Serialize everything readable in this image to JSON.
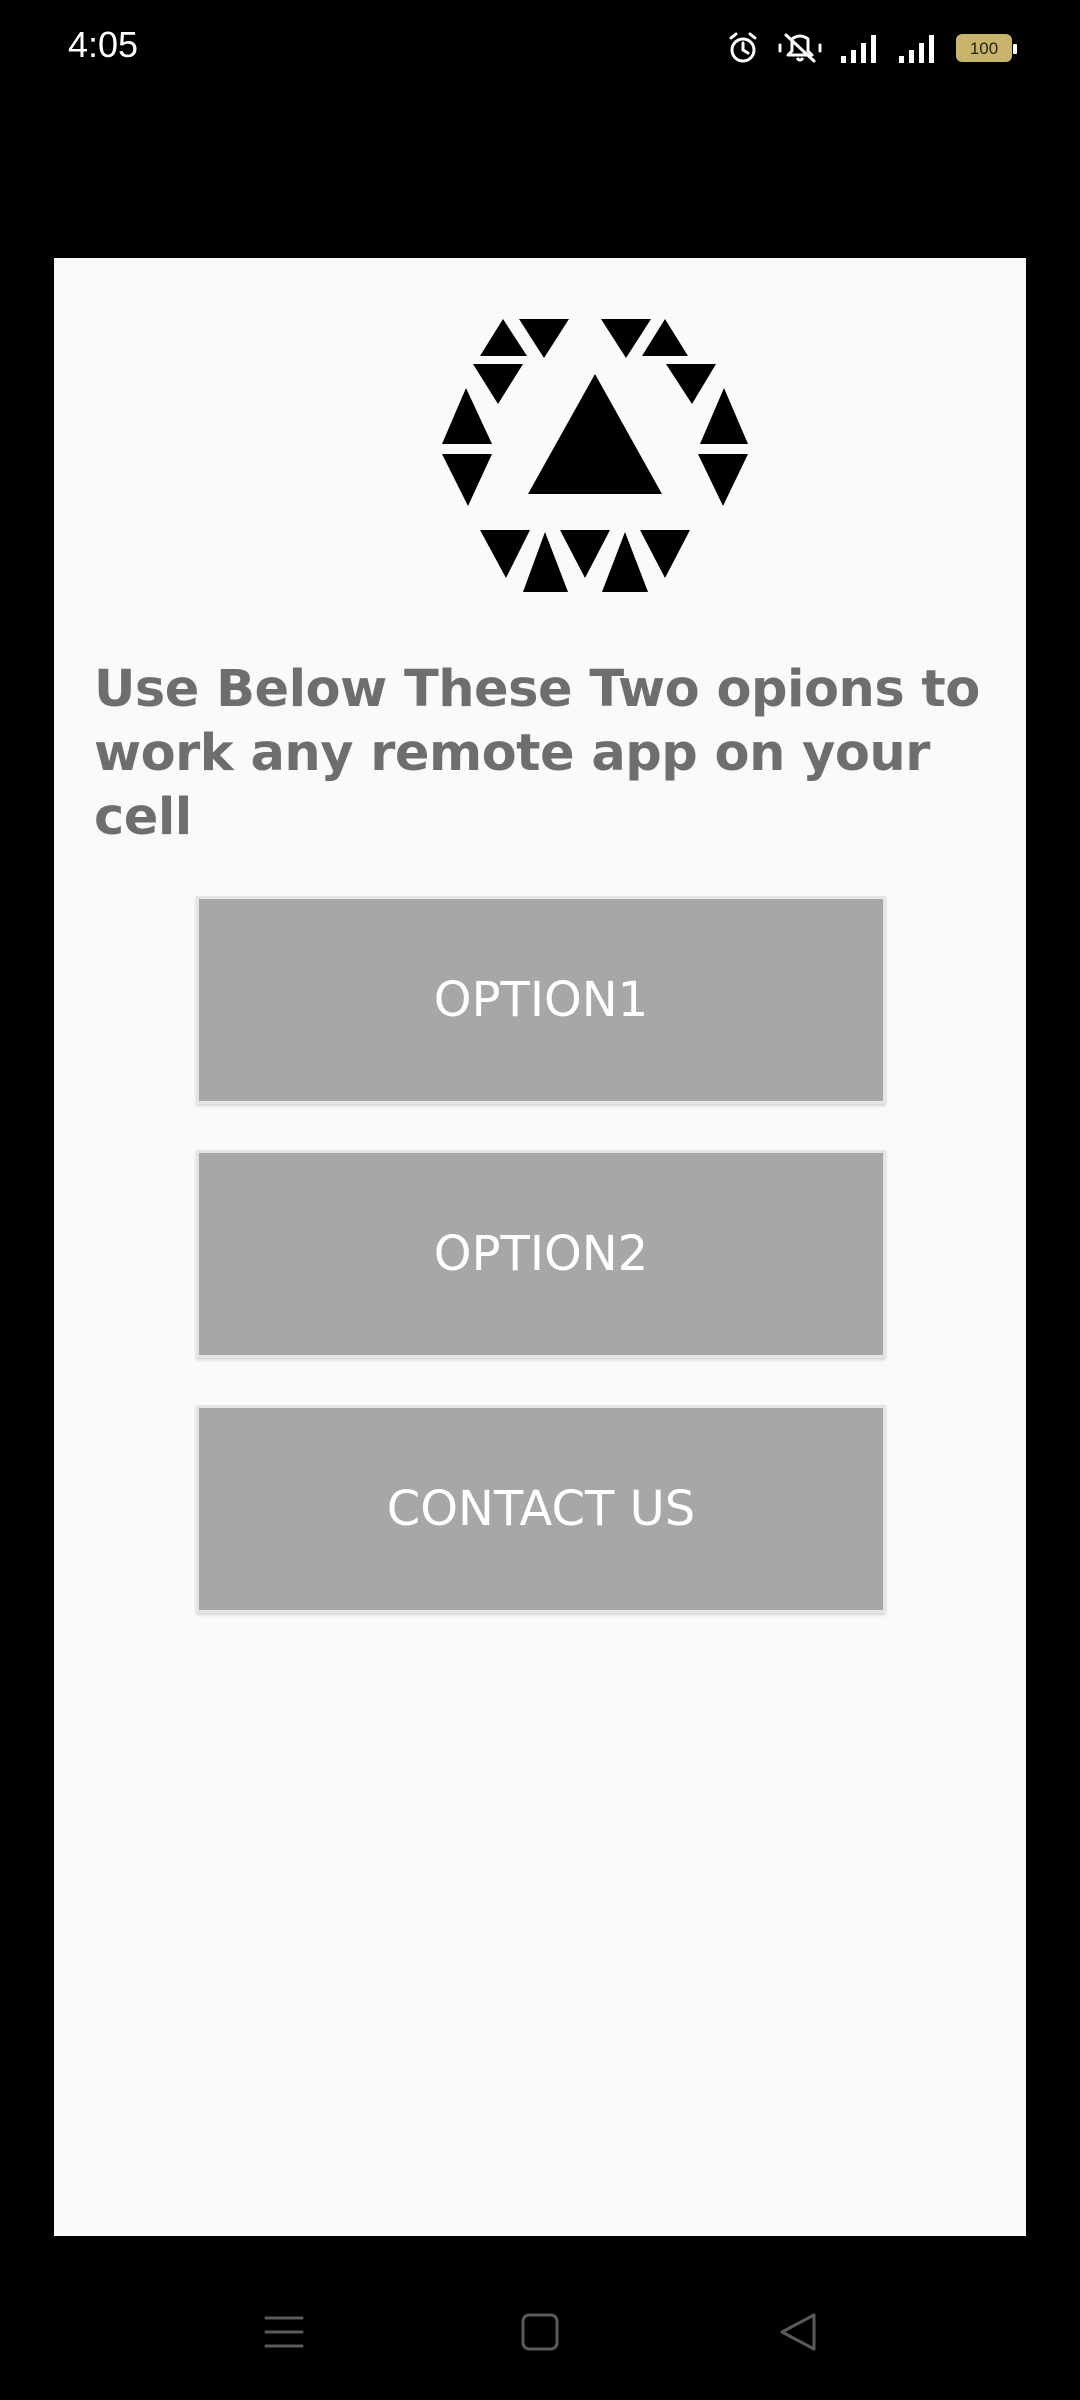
{
  "status_bar": {
    "time": "4:05",
    "icons": [
      "alarm-icon",
      "mute-icon",
      "signal-icon",
      "signal-icon"
    ],
    "battery": "100"
  },
  "main": {
    "logo": "triangle-hexagon-logo",
    "heading": "Use Below These Two opions to work any remote app on your cell",
    "buttons": [
      {
        "label": "OPTION1"
      },
      {
        "label": "OPTION2"
      },
      {
        "label": "CONTACT US"
      }
    ]
  },
  "nav_bar": {
    "icons": [
      "menu-icon",
      "home-icon",
      "back-icon"
    ]
  },
  "colors": {
    "card_background": "#fafafa",
    "button_background": "#a7a7a7",
    "heading_text": "#6e6e6e",
    "system_bar": "#000000"
  }
}
